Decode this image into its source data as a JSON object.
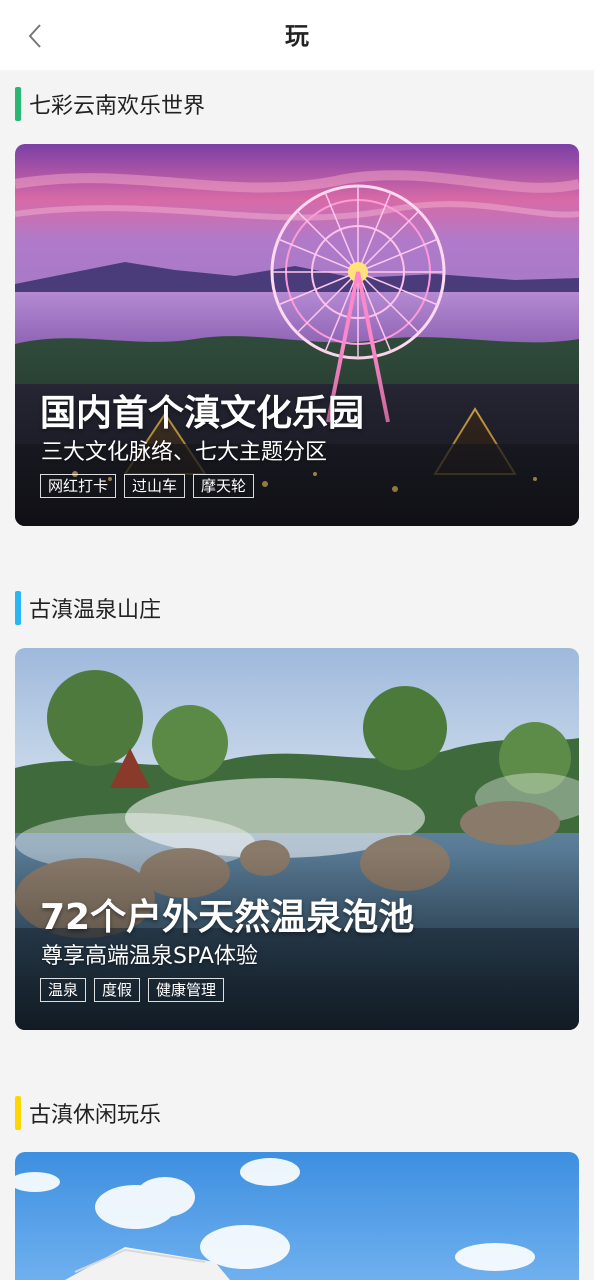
{
  "header": {
    "title": "玩"
  },
  "sections": [
    {
      "title": "七彩云南欢乐世界",
      "accent": "#2bb673",
      "card": {
        "headline": "国内首个滇文化乐园",
        "subline": "三大文化脉络、七大主题分区",
        "tags": [
          "网红打卡",
          "过山车",
          "摩天轮"
        ]
      }
    },
    {
      "title": "古滇温泉山庄",
      "accent": "#29b6f6",
      "card": {
        "headline": "72个户外天然温泉泡池",
        "subline": "尊享高端温泉SPA体验",
        "tags": [
          "温泉",
          "度假",
          "健康管理"
        ]
      }
    },
    {
      "title": "古滇休闲玩乐",
      "accent": "#ffd600"
    }
  ]
}
